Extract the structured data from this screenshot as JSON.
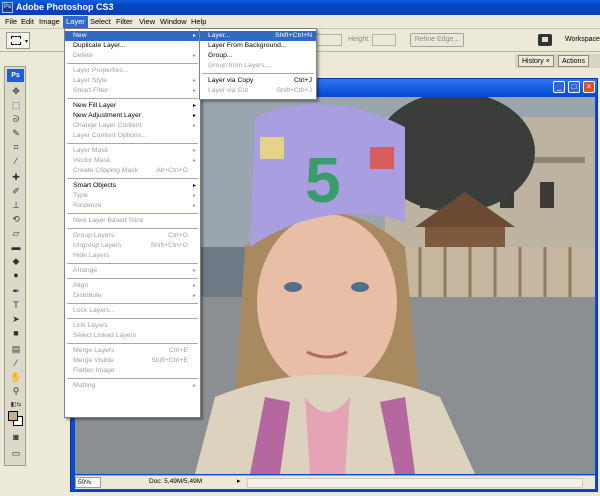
{
  "app": {
    "title": "Adobe Photoshop CS3",
    "icon": "photoshop-icon"
  },
  "menubar": [
    "File",
    "Edit",
    "Image",
    "Layer",
    "Select",
    "Filter",
    "View",
    "Window",
    "Help"
  ],
  "options": {
    "height_label": "Height:",
    "refine_edge": "Refine Edge...",
    "workspace": "Workspace"
  },
  "palette_tabs": [
    "History",
    "Actions"
  ],
  "toolbox": {
    "logo": "Ps"
  },
  "document": {
    "zoom": "50%",
    "doc_size": "Doc: 5,49M/5,49M"
  },
  "layer_menu": [
    {
      "label": "New",
      "arrow": true,
      "highlight": true
    },
    {
      "label": "Duplicate Layer..."
    },
    {
      "label": "Delete",
      "arrow": true,
      "disabled": true
    },
    {
      "sep": true
    },
    {
      "label": "Layer Properties...",
      "disabled": true
    },
    {
      "label": "Layer Style",
      "arrow": true,
      "disabled": true
    },
    {
      "label": "Smart Filter",
      "arrow": true,
      "disabled": true
    },
    {
      "sep": true
    },
    {
      "label": "New Fill Layer",
      "arrow": true
    },
    {
      "label": "New Adjustment Layer",
      "arrow": true
    },
    {
      "label": "Change Layer Content",
      "arrow": true,
      "disabled": true
    },
    {
      "label": "Layer Content Options...",
      "disabled": true
    },
    {
      "sep": true
    },
    {
      "label": "Layer Mask",
      "arrow": true,
      "disabled": true
    },
    {
      "label": "Vector Mask",
      "arrow": true,
      "disabled": true
    },
    {
      "label": "Create Clipping Mask",
      "shortcut": "Alt+Ctrl+G",
      "disabled": true
    },
    {
      "sep": true
    },
    {
      "label": "Smart Objects",
      "arrow": true
    },
    {
      "label": "Type",
      "arrow": true,
      "disabled": true
    },
    {
      "label": "Rasterize",
      "arrow": true,
      "disabled": true
    },
    {
      "sep": true
    },
    {
      "label": "New Layer Based Slice",
      "disabled": true
    },
    {
      "sep": true
    },
    {
      "label": "Group Layers",
      "shortcut": "Ctrl+G",
      "disabled": true
    },
    {
      "label": "Ungroup Layers",
      "shortcut": "Shift+Ctrl+G",
      "disabled": true
    },
    {
      "label": "Hide Layers",
      "disabled": true
    },
    {
      "sep": true
    },
    {
      "label": "Arrange",
      "arrow": true,
      "disabled": true
    },
    {
      "sep": true
    },
    {
      "label": "Align",
      "arrow": true,
      "disabled": true
    },
    {
      "label": "Distribute",
      "arrow": true,
      "disabled": true
    },
    {
      "sep": true
    },
    {
      "label": "Lock Layers...",
      "disabled": true
    },
    {
      "sep": true
    },
    {
      "label": "Link Layers",
      "disabled": true
    },
    {
      "label": "Select Linked Layers",
      "disabled": true
    },
    {
      "sep": true
    },
    {
      "label": "Merge Layers",
      "shortcut": "Ctrl+E",
      "disabled": true
    },
    {
      "label": "Merge Visible",
      "shortcut": "Shift+Ctrl+E",
      "disabled": true
    },
    {
      "label": "Flatten Image",
      "disabled": true
    },
    {
      "sep": true
    },
    {
      "label": "Matting",
      "arrow": true,
      "disabled": true
    }
  ],
  "new_submenu": [
    {
      "label": "Layer...",
      "shortcut": "Shift+Ctrl+N",
      "highlight": true
    },
    {
      "label": "Layer From Background..."
    },
    {
      "label": "Group..."
    },
    {
      "label": "Group from Layers...",
      "disabled": true
    },
    {
      "sep": true
    },
    {
      "label": "Layer via Copy",
      "shortcut": "Ctrl+J"
    },
    {
      "label": "Layer via Cut",
      "shortcut": "Shift+Ctrl+J",
      "disabled": true
    }
  ],
  "photo": {
    "crown_number": "5"
  }
}
